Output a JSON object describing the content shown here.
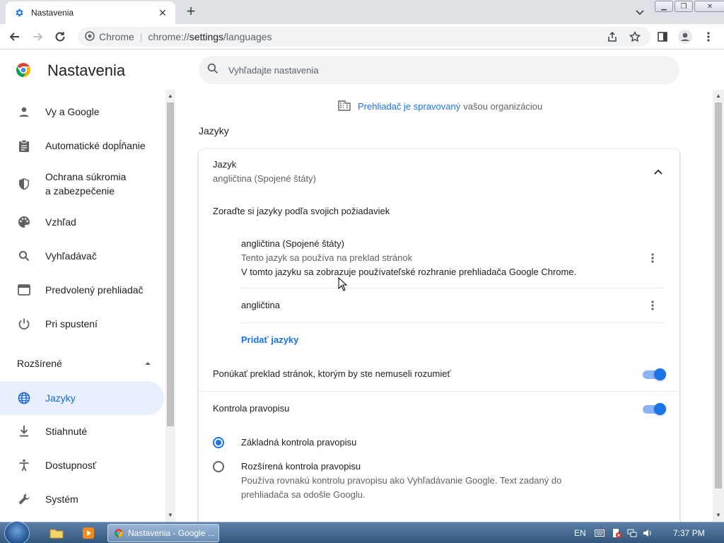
{
  "browser": {
    "tab_title": "Nastavenia",
    "omnibox_site": "Chrome",
    "omnibox_url_scheme": "chrome://",
    "omnibox_url_host": "settings",
    "omnibox_url_path": "/languages"
  },
  "header": {
    "title": "Nastavenia",
    "search_placeholder": "Vyhľadajte nastavenia"
  },
  "sidebar": {
    "items": [
      {
        "label": "Vy a Google",
        "icon": "person-icon"
      },
      {
        "label": "Automatické dopĺňanie",
        "icon": "clipboard-icon"
      },
      {
        "label": "Ochrana súkromia",
        "label2": "a zabezpečenie",
        "icon": "shield-icon"
      },
      {
        "label": "Vzhľad",
        "icon": "palette-icon"
      },
      {
        "label": "Vyhľadávač",
        "icon": "search-icon"
      },
      {
        "label": "Predvolený prehliadač",
        "icon": "browser-icon"
      },
      {
        "label": "Pri spustení",
        "icon": "power-icon"
      }
    ],
    "advanced_label": "Rozšírené",
    "advanced_items": [
      {
        "label": "Jazyky",
        "icon": "globe-icon",
        "active": true
      },
      {
        "label": "Stiahnuté",
        "icon": "download-icon"
      },
      {
        "label": "Dostupnosť",
        "icon": "accessibility-icon"
      },
      {
        "label": "Systém",
        "icon": "wrench-icon"
      }
    ]
  },
  "main": {
    "managed_link": "Prehliadač je spravovaný",
    "managed_rest": "vašou organizáciou",
    "section_title": "Jazyky",
    "language_header": "Jazyk",
    "language_value": "angličtina (Spojené štáty)",
    "order_text": "Zoraďte si jazyky podľa svojich požiadaviek",
    "languages": [
      {
        "name": "angličtina (Spojené štáty)",
        "note1": "Tento jazyk sa používa na preklad stránok",
        "note2": "V tomto jazyku sa zobrazuje používateľské rozhranie prehliadača Google Chrome."
      },
      {
        "name": "angličtina"
      }
    ],
    "add_languages": "Pridať jazyky",
    "offer_translate": "Ponúkať preklad stránok, ktorým by ste nemuseli rozumieť",
    "offer_translate_on": true,
    "spellcheck": "Kontrola pravopisu",
    "spellcheck_on": true,
    "basic_spell": "Základná kontrola pravopisu",
    "enhanced_spell": "Rozšírená kontrola pravopisu",
    "enhanced_desc1": "Používa rovnakú kontrolu pravopisu ako Vyhľadávanie Google. Text zadaný do",
    "enhanced_desc2": "prehliadača sa odošle Googlu.",
    "selected_spell": "basic"
  },
  "taskbar": {
    "task_label": "Nastavenia - Google ...",
    "lang": "EN",
    "time": "7:37 PM"
  },
  "colors": {
    "accent": "#1a73e8",
    "active_nav_bg": "#e8f0fe"
  }
}
